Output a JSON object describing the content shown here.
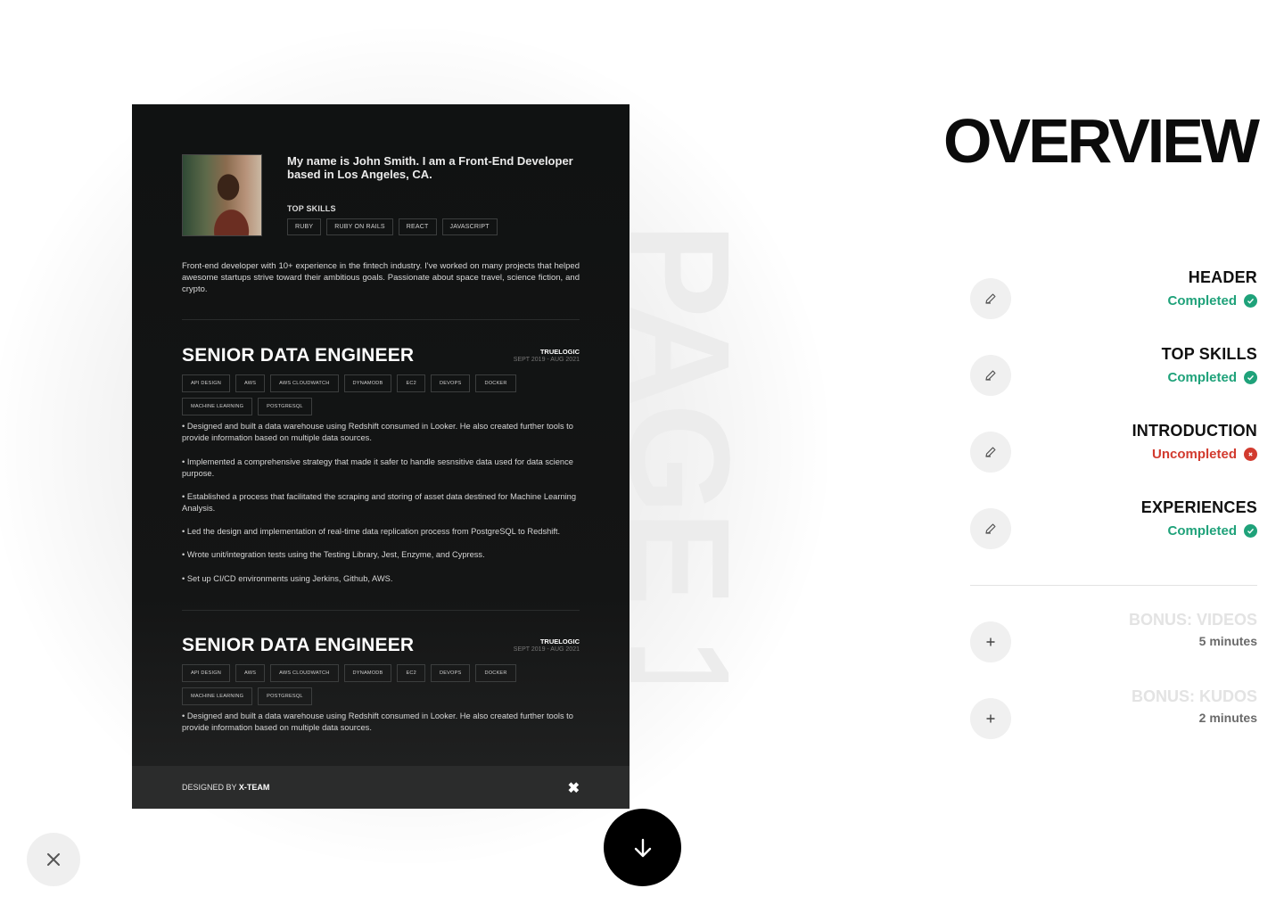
{
  "watermark": "PAGE 1",
  "resume": {
    "intro": "My name is John Smith. I am a Front-End Developer based in Los Angeles, CA.",
    "skills_label": "TOP SKILLS",
    "skills": [
      "RUBY",
      "RUBY ON RAILS",
      "REACT",
      "JAVASCRIPT"
    ],
    "bio": "Front-end developer with 10+ experience in the fintech industry. I've worked on many projects that helped awesome startups strive toward their ambitious goals. Passionate about space travel, science fiction, and crypto.",
    "experiences": [
      {
        "title": "SENIOR DATA ENGINEER",
        "company": "TRUELOGIC",
        "dates": "SEPT 2019 - AUG 2021",
        "tags": [
          "API DESIGN",
          "AWS",
          "AWS CLOUDWATCH",
          "DYNAMODB",
          "EC2",
          "DEVOPS",
          "DOCKER",
          "MACHINE LEARNING",
          "POSTGRESQL"
        ],
        "bullets": [
          "• Designed and built a data warehouse using Redshift consumed in Looker. He also created further tools to provide information based on multiple data sources.",
          "• Implemented a comprehensive strategy that made it safer to handle sesnsitive data used for data science purpose.",
          "• Established a process that facilitated the scraping and storing of asset data destined for Machine Learning Analysis.",
          "• Led the design and implementation of real-time data replication process from PostgreSQL to Redshift.",
          "• Wrote unit/integration tests using the Testing Library, Jest, Enzyme, and Cypress.",
          "• Set up CI/CD environments using Jerkins, Github, AWS."
        ]
      },
      {
        "title": "SENIOR DATA ENGINEER",
        "company": "TRUELOGIC",
        "dates": "SEPT 2019 - AUG 2021",
        "tags": [
          "API DESIGN",
          "AWS",
          "AWS CLOUDWATCH",
          "DYNAMODB",
          "EC2",
          "DEVOPS",
          "DOCKER",
          "MACHINE LEARNING",
          "POSTGRESQL"
        ],
        "bullets": [
          "• Designed and built a data warehouse using Redshift consumed in Looker. He also created further tools to provide information based on multiple data sources."
        ]
      }
    ],
    "footer": {
      "designed_prefix": "DESIGNED BY ",
      "designed_brand": "X-TEAM",
      "logo_icon": "x-team-logo-icon"
    }
  },
  "overview": {
    "title": "OVERVIEW",
    "sections": [
      {
        "name": "HEADER",
        "status": "Completed",
        "state": "completed",
        "icon": "pencil-icon"
      },
      {
        "name": "TOP SKILLS",
        "status": "Completed",
        "state": "completed",
        "icon": "pencil-icon"
      },
      {
        "name": "INTRODUCTION",
        "status": "Uncompleted",
        "state": "uncompleted",
        "icon": "pencil-icon"
      },
      {
        "name": "EXPERIENCES",
        "status": "Completed",
        "state": "completed",
        "icon": "pencil-icon"
      }
    ],
    "bonus": [
      {
        "name": "BONUS: VIDEOS",
        "time": "5 minutes",
        "icon": "plus-icon"
      },
      {
        "name": "BONUS: KUDOS",
        "time": "2 minutes",
        "icon": "plus-icon"
      }
    ]
  },
  "colors": {
    "completed": "#1fa27a",
    "uncompleted": "#d23b2f"
  },
  "buttons": {
    "download_icon": "arrow-down-icon",
    "close_icon": "close-icon"
  }
}
